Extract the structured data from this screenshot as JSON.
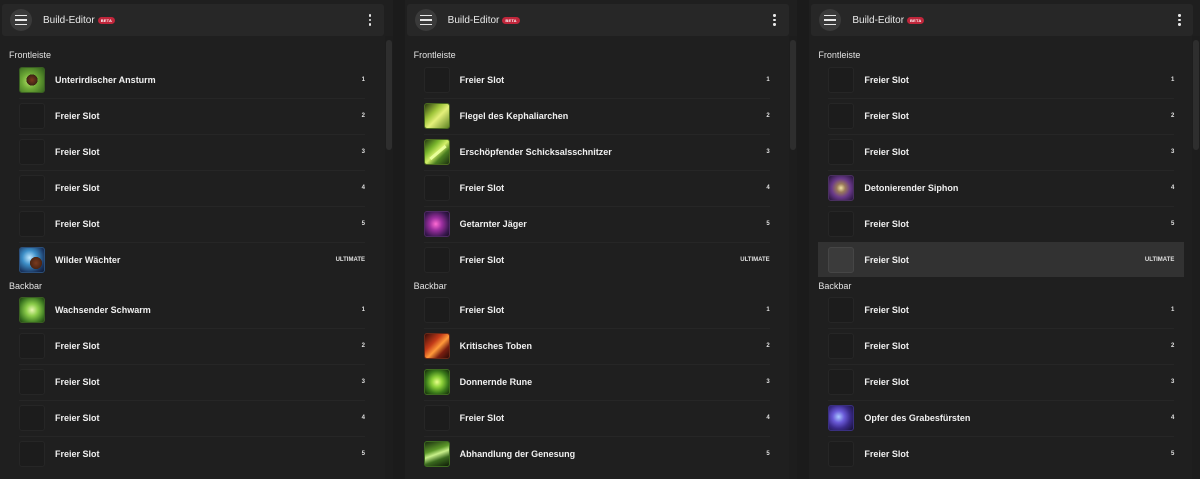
{
  "app": {
    "title": "Build-Editor",
    "badge": "BETA"
  },
  "sections": {
    "front": "Frontleiste",
    "back": "Backbar"
  },
  "screens": [
    {
      "front": [
        {
          "name": "Unterirdischer Ansturm",
          "num": "1",
          "icon": "green"
        },
        {
          "name": "Freier Slot",
          "num": "2",
          "icon": ""
        },
        {
          "name": "Freier Slot",
          "num": "3",
          "icon": ""
        },
        {
          "name": "Freier Slot",
          "num": "4",
          "icon": ""
        },
        {
          "name": "Freier Slot",
          "num": "5",
          "icon": ""
        },
        {
          "name": "Wilder Wächter",
          "num": "ULTIMATE",
          "icon": "wolf"
        }
      ],
      "back": [
        {
          "name": "Wachsender Schwarm",
          "num": "1",
          "icon": "swarm"
        },
        {
          "name": "Freier Slot",
          "num": "2",
          "icon": ""
        },
        {
          "name": "Freier Slot",
          "num": "3",
          "icon": ""
        },
        {
          "name": "Freier Slot",
          "num": "4",
          "icon": ""
        },
        {
          "name": "Freier Slot",
          "num": "5",
          "icon": ""
        }
      ]
    },
    {
      "front": [
        {
          "name": "Freier Slot",
          "num": "1",
          "icon": ""
        },
        {
          "name": "Flegel des Kephaliarchen",
          "num": "2",
          "icon": "yellow"
        },
        {
          "name": "Erschöpfender Schicksalsschnitzer",
          "num": "3",
          "icon": "blade"
        },
        {
          "name": "Freier Slot",
          "num": "4",
          "icon": ""
        },
        {
          "name": "Getarnter Jäger",
          "num": "5",
          "icon": "purple"
        },
        {
          "name": "Freier Slot",
          "num": "ULTIMATE",
          "icon": ""
        }
      ],
      "back": [
        {
          "name": "Freier Slot",
          "num": "1",
          "icon": ""
        },
        {
          "name": "Kritisches Toben",
          "num": "2",
          "icon": "fire"
        },
        {
          "name": "Donnernde Rune",
          "num": "3",
          "icon": "rune"
        },
        {
          "name": "Freier Slot",
          "num": "4",
          "icon": ""
        },
        {
          "name": "Abhandlung der Genesung",
          "num": "5",
          "icon": "heal"
        }
      ]
    },
    {
      "front": [
        {
          "name": "Freier Slot",
          "num": "1",
          "icon": ""
        },
        {
          "name": "Freier Slot",
          "num": "2",
          "icon": ""
        },
        {
          "name": "Freier Slot",
          "num": "3",
          "icon": ""
        },
        {
          "name": "Detonierender Siphon",
          "num": "4",
          "icon": "siphon"
        },
        {
          "name": "Freier Slot",
          "num": "5",
          "icon": ""
        },
        {
          "name": "Freier Slot",
          "num": "ULTIMATE",
          "icon": "",
          "selected": true
        }
      ],
      "back": [
        {
          "name": "Freier Slot",
          "num": "1",
          "icon": ""
        },
        {
          "name": "Freier Slot",
          "num": "2",
          "icon": ""
        },
        {
          "name": "Freier Slot",
          "num": "3",
          "icon": ""
        },
        {
          "name": "Opfer des Grabesfürsten",
          "num": "4",
          "icon": "tomb"
        },
        {
          "name": "Freier Slot",
          "num": "5",
          "icon": ""
        }
      ]
    }
  ]
}
